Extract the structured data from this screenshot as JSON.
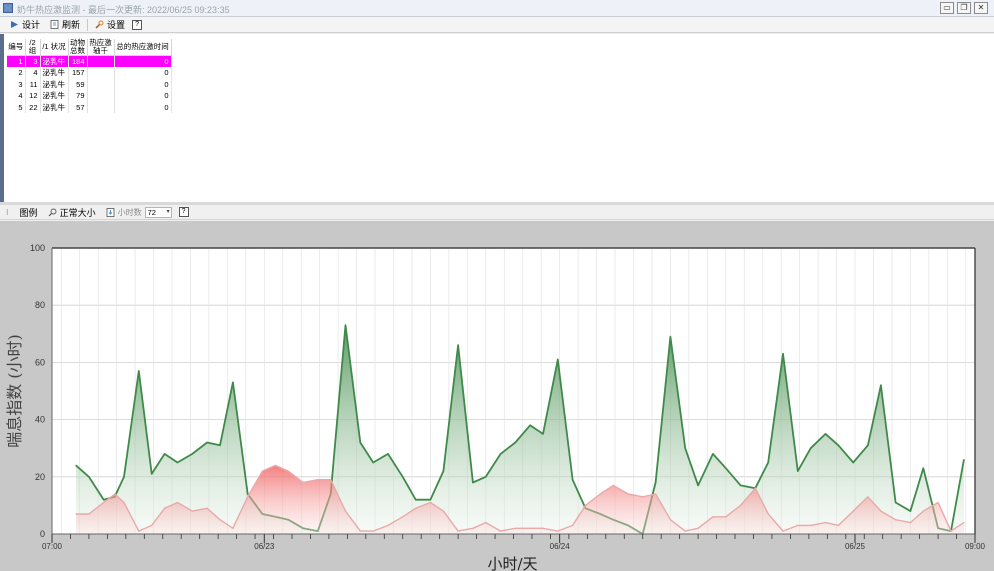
{
  "window": {
    "title": "奶牛热应激监测 - 最后一次更新: 2022/06/25 09:23:35",
    "controls": [
      "▭",
      "❐",
      "✕"
    ]
  },
  "toolbar": {
    "design_label": "设计",
    "refresh_label": "刷新",
    "settings_label": "设置",
    "help_glyph": "?"
  },
  "table": {
    "headers": [
      "编号",
      "/2 组",
      "/1 状况",
      "动物 总数",
      "热应激 轴千",
      "总的热应激时间"
    ],
    "rows": [
      [
        "1",
        "3",
        "泌乳牛",
        "184",
        "",
        "0"
      ],
      [
        "2",
        "4",
        "泌乳牛",
        "157",
        "",
        "0"
      ],
      [
        "3",
        "11",
        "泌乳牛",
        "59",
        "",
        "0"
      ],
      [
        "4",
        "12",
        "泌乳牛",
        "79",
        "",
        "0"
      ],
      [
        "5",
        "22",
        "泌乳牛",
        "57",
        "",
        "0"
      ]
    ],
    "selected_row": 0
  },
  "chart_toolbar": {
    "legend_label": "图例",
    "normal_size_label": "正常大小",
    "hours_label": "小时数",
    "hours_value": "72",
    "help_glyph": "?"
  },
  "colors": {
    "selection": "#ff00ff",
    "green_line": "#3f8a4a",
    "red_line": "#e06a6a",
    "pink_line": "#e9a9a9"
  },
  "chart_data": {
    "type": "area",
    "ylabel": "喘息指数 (小时)",
    "xlabel": "小时/天",
    "ylim": [
      0,
      100
    ],
    "yticks": [
      0,
      20,
      40,
      60,
      80,
      100
    ],
    "xlim": [
      0,
      50
    ],
    "xticks": [
      {
        "x": 0,
        "label": "07:00"
      },
      {
        "x": 11.5,
        "label": "06/23"
      },
      {
        "x": 27.5,
        "label": "06/24"
      },
      {
        "x": 43.5,
        "label": "06/25"
      },
      {
        "x": 50,
        "label": "09:00"
      }
    ],
    "grid": true,
    "series": [
      {
        "color": "green",
        "x": [
          1.3,
          2.0,
          2.8,
          3.4,
          3.9,
          4.7,
          5.4,
          6.1,
          6.8,
          7.6,
          8.4,
          9.1,
          9.8,
          10.6,
          11.4,
          12.1,
          12.8,
          13.6,
          14.4,
          15.1,
          15.9,
          16.7,
          17.4,
          18.2,
          19.0,
          19.7,
          20.5,
          21.2,
          22.0,
          22.8,
          23.5,
          24.3,
          25.1,
          25.9,
          26.6,
          27.4,
          28.2,
          28.9,
          29.7,
          30.4,
          31.2,
          32.0,
          32.7,
          33.5,
          34.3,
          35.0,
          35.8,
          36.5,
          37.3,
          38.1,
          38.8,
          39.6,
          40.4,
          41.1,
          41.9,
          42.6,
          43.4,
          44.2,
          44.9,
          45.7,
          46.5,
          47.2,
          48.0,
          48.7,
          49.4
        ],
        "values": [
          24,
          20,
          12,
          13,
          20,
          57,
          21,
          28,
          25,
          28,
          32,
          31,
          53,
          14,
          7,
          6,
          5,
          2,
          1,
          14,
          73,
          32,
          25,
          28,
          20,
          12,
          12,
          22,
          66,
          18,
          20,
          28,
          32,
          38,
          35,
          61,
          19,
          9,
          7,
          5,
          3,
          0,
          18,
          69,
          30,
          17,
          28,
          23,
          17,
          16,
          25,
          63,
          22,
          30,
          35,
          31,
          25,
          31,
          52,
          11,
          8,
          23,
          2,
          1,
          26
        ]
      },
      {
        "color": "red",
        "x": [
          1.3,
          2.0,
          2.8,
          3.4,
          3.9,
          4.7,
          5.4,
          6.1,
          6.8,
          7.6,
          8.4,
          9.1,
          9.8,
          10.6,
          11.4,
          12.1,
          12.8,
          13.6,
          14.4,
          15.1,
          15.9,
          16.7,
          17.4,
          18.2,
          19.0,
          19.7,
          20.5,
          21.2,
          22.0,
          22.8,
          23.5,
          24.3,
          25.1,
          25.9,
          26.6,
          27.4,
          28.2,
          28.9,
          29.7,
          30.4,
          31.2,
          32.0,
          32.7,
          33.5,
          34.3,
          35.0,
          35.8,
          36.5,
          37.3,
          38.1,
          38.8,
          39.6,
          40.4,
          41.1,
          41.9,
          42.6,
          43.4,
          44.2,
          44.9,
          45.7,
          46.5,
          47.2,
          48.0,
          48.7,
          49.4
        ],
        "values": [
          7,
          7,
          11,
          14,
          11,
          1,
          3,
          9,
          11,
          8,
          9,
          5,
          2,
          13,
          22,
          24,
          22,
          18,
          19,
          19,
          8,
          1,
          1,
          3,
          6,
          9,
          11,
          8,
          1,
          2,
          4,
          1,
          2,
          2,
          2,
          1,
          3,
          10,
          14,
          17,
          14,
          13,
          14,
          5,
          1,
          2,
          6,
          6,
          10,
          16,
          7,
          1,
          3,
          3,
          4,
          3,
          8,
          13,
          8,
          5,
          4,
          8,
          11,
          1,
          4
        ]
      }
    ]
  }
}
